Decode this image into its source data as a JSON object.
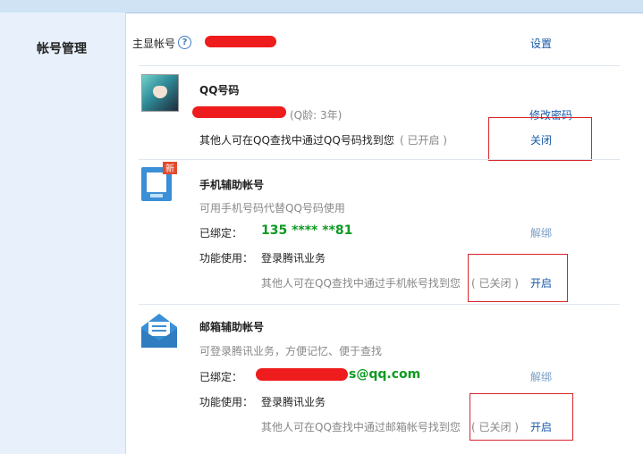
{
  "sidebar": {
    "title": "帐号管理"
  },
  "main_account": {
    "label": "主显帐号",
    "help_icon": "?",
    "settings_link": "设置"
  },
  "qq": {
    "title": "QQ号码",
    "age": "(Q龄: 3年)",
    "change_password": "修改密码",
    "findable_text": "其他人可在QQ查找中通过QQ号码找到您",
    "status": "( 已开启 )",
    "toggle": "关闭"
  },
  "phone": {
    "badge": "新",
    "title": "手机辅助帐号",
    "desc": "可用手机号码代替QQ号码使用",
    "bound_label": "已绑定：",
    "bound_value": "135 **** **81",
    "unbind": "解绑",
    "func_label": "功能使用：",
    "func_value": "登录腾讯业务",
    "findable_text": "其他人可在QQ查找中通过手机帐号找到您",
    "status": "( 已关闭 )",
    "toggle": "开启"
  },
  "email": {
    "title": "邮箱辅助帐号",
    "desc": "可登录腾讯业务，方便记忆、便于查找",
    "bound_label": "已绑定：",
    "bound_value_suffix": "s@qq.com",
    "unbind": "解绑",
    "func_label": "功能使用：",
    "func_value": "登录腾讯业务",
    "findable_text": "其他人可在QQ查找中通过邮箱帐号找到您",
    "status": "( 已关闭 )",
    "toggle": "开启"
  },
  "colors": {
    "link": "#1a5aa8",
    "green": "#0e9a22",
    "redaction": "#ee1c1c",
    "highlight_box": "#d8262b"
  }
}
